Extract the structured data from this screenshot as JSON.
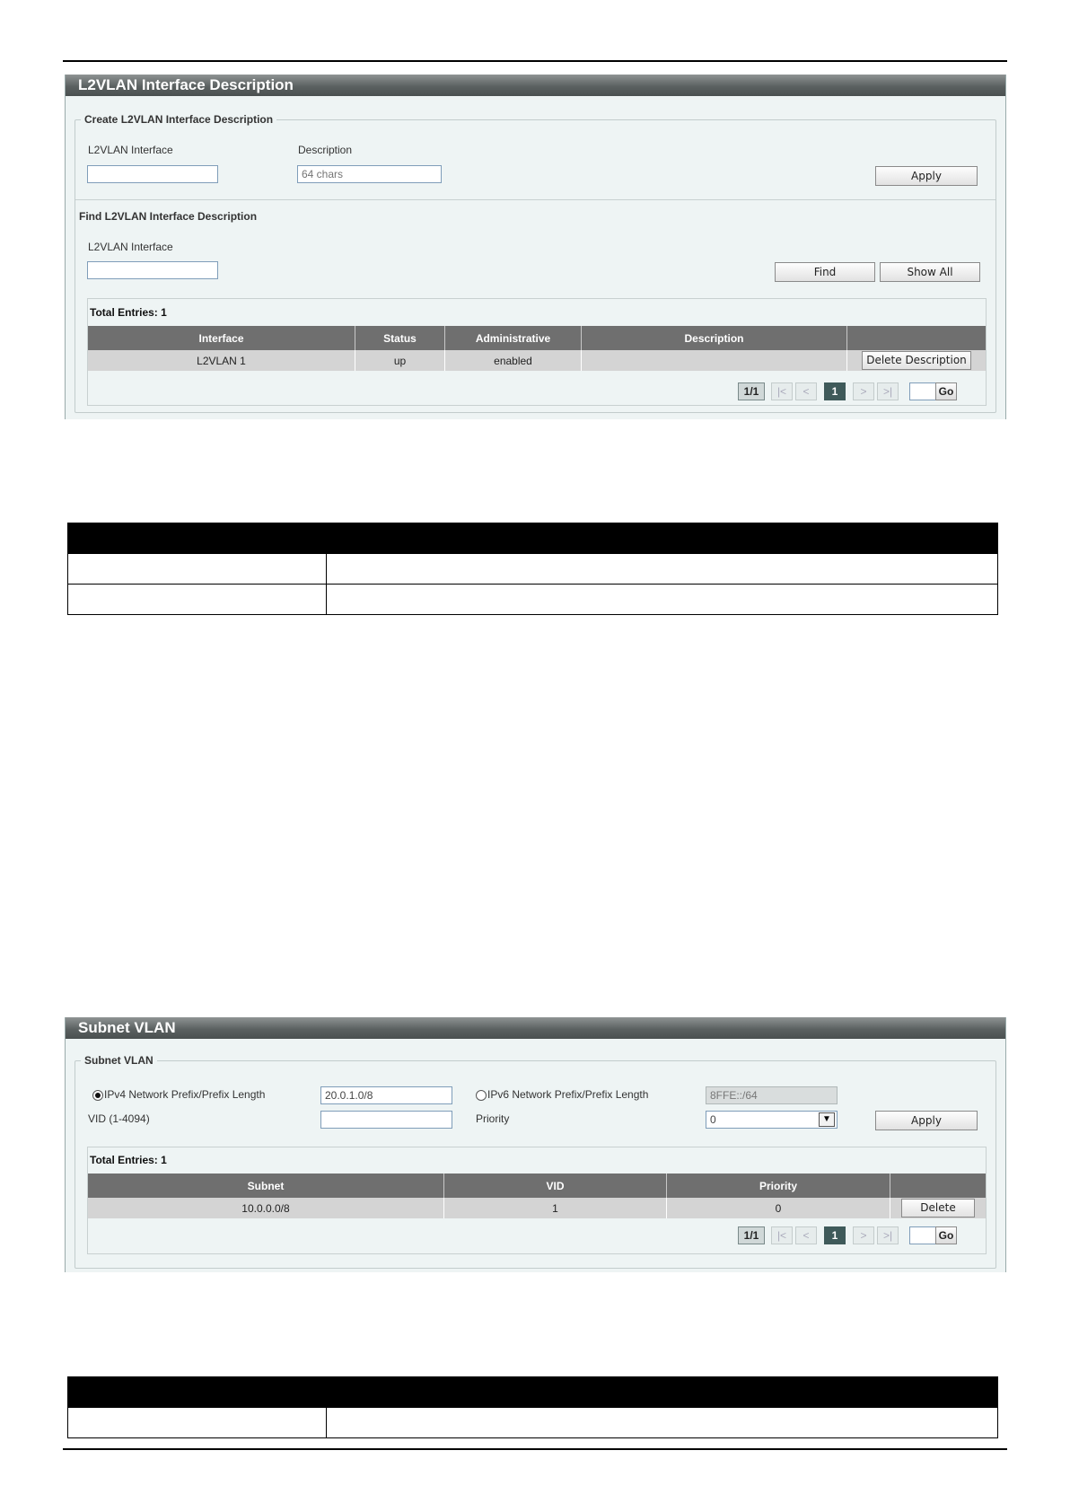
{
  "panel1": {
    "title": "L2VLAN Interface Description",
    "create": {
      "legend": "Create L2VLAN Interface Description",
      "interface_label": "L2VLAN Interface",
      "interface_value": "",
      "description_label": "Description",
      "description_placeholder": "64 chars",
      "apply_label": "Apply"
    },
    "find": {
      "heading": "Find L2VLAN Interface Description",
      "interface_label": "L2VLAN Interface",
      "interface_value": "",
      "find_label": "Find",
      "show_all_label": "Show All"
    },
    "table": {
      "total": "Total Entries: 1",
      "headers": [
        "Interface",
        "Status",
        "Administrative",
        "Description",
        ""
      ],
      "rows": [
        {
          "interface": "L2VLAN 1",
          "status": "up",
          "administrative": "enabled",
          "description": "",
          "action": "Delete Description"
        }
      ]
    },
    "pager": {
      "page_of": "1/1",
      "first": "|<",
      "prev": "<",
      "current": "1",
      "next": ">",
      "last": ">|",
      "go": "Go"
    }
  },
  "panel2": {
    "title": "Subnet VLAN",
    "legend": "Subnet VLAN",
    "ipv4_label": "IPv4 Network Prefix/Prefix Length",
    "ipv4_selected": true,
    "ipv4_value": "20.0.1.0/8",
    "ipv6_label": "IPv6 Network Prefix/Prefix Length",
    "ipv6_value": "8FFE::/64",
    "vid_label": "VID (1-4094)",
    "vid_value": "",
    "priority_label": "Priority",
    "priority_value": "0",
    "apply_label": "Apply",
    "table": {
      "total": "Total Entries: 1",
      "headers": [
        "Subnet",
        "VID",
        "Priority",
        ""
      ],
      "rows": [
        {
          "subnet": "10.0.0.0/8",
          "vid": "1",
          "priority": "0",
          "action": "Delete"
        }
      ]
    },
    "pager": {
      "page_of": "1/1",
      "first": "|<",
      "prev": "<",
      "current": "1",
      "next": ">",
      "last": ">|",
      "go": "Go"
    }
  }
}
